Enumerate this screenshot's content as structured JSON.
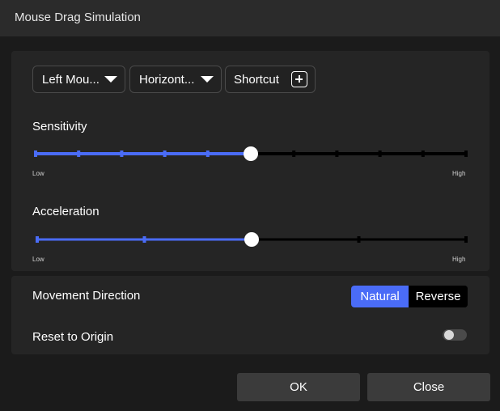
{
  "window": {
    "title": "Mouse Drag Simulation"
  },
  "toolbar": {
    "button_dropdown": "Left Mou...",
    "direction_dropdown": "Horizont...",
    "shortcut_label": "Shortcut"
  },
  "sensitivity": {
    "label": "Sensitivity",
    "low": "Low",
    "high": "High",
    "value": 0.5,
    "ticks": 11
  },
  "acceleration": {
    "label": "Acceleration",
    "low": "Low",
    "high": "High",
    "value": 0.5,
    "ticks": 5
  },
  "movement": {
    "label": "Movement Direction",
    "options": [
      "Natural",
      "Reverse"
    ],
    "selected": "Natural"
  },
  "reset": {
    "label": "Reset to Origin",
    "enabled": false
  },
  "footer": {
    "ok": "OK",
    "close": "Close"
  },
  "colors": {
    "accent": "#4a6cf7",
    "track": "#000000",
    "thumb": "#ffffff"
  }
}
